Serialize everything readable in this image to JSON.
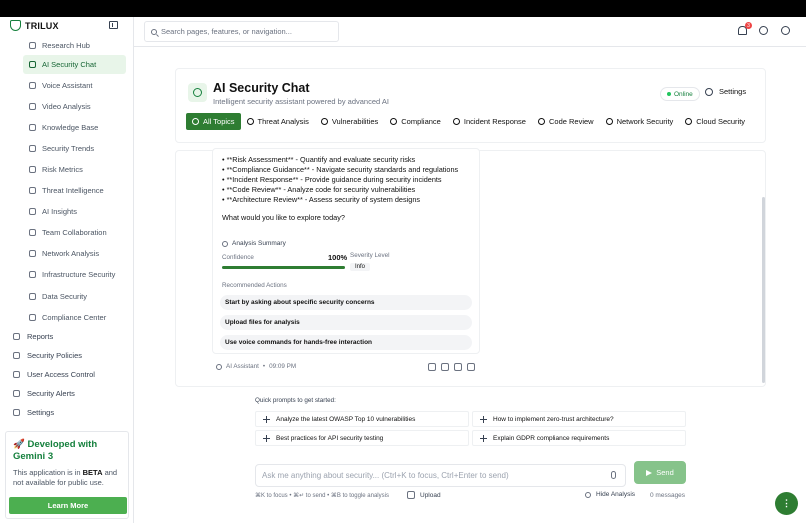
{
  "brand": {
    "name": "TRILUX"
  },
  "sidebar": {
    "items": [
      {
        "label": "Research Hub",
        "icon": "search-icon",
        "active": false
      },
      {
        "label": "AI Security Chat",
        "icon": "chat-icon",
        "active": true
      },
      {
        "label": "Voice Assistant",
        "icon": "mic-icon",
        "active": false
      },
      {
        "label": "Video Analysis",
        "icon": "video-icon",
        "active": false
      },
      {
        "label": "Knowledge Base",
        "icon": "book-icon",
        "active": false
      },
      {
        "label": "Security Trends",
        "icon": "trend-icon",
        "active": false
      },
      {
        "label": "Risk Metrics",
        "icon": "chart-icon",
        "active": false
      },
      {
        "label": "Threat Intelligence",
        "icon": "target-icon",
        "active": false
      },
      {
        "label": "AI Insights",
        "icon": "bulb-icon",
        "active": false
      },
      {
        "label": "Team Collaboration",
        "icon": "users-icon",
        "active": false
      },
      {
        "label": "Network Analysis",
        "icon": "network-icon",
        "active": false
      },
      {
        "label": "Infrastructure Security",
        "icon": "server-icon",
        "active": false
      },
      {
        "label": "Data Security",
        "icon": "database-icon",
        "active": false
      },
      {
        "label": "Compliance Center",
        "icon": "lock-icon",
        "active": false
      }
    ],
    "top_items": [
      {
        "label": "Reports",
        "icon": "file-icon"
      },
      {
        "label": "Security Policies",
        "icon": "shield-icon"
      },
      {
        "label": "User Access Control",
        "icon": "user-circle-icon"
      },
      {
        "label": "Security Alerts",
        "icon": "alert-icon"
      },
      {
        "label": "Settings",
        "icon": "sliders-icon"
      }
    ],
    "gemini": {
      "title": "🚀 Developed with Gemini 3",
      "body_prefix": "This application is in ",
      "body_bold": "BETA",
      "body_suffix": " and not available for public use.",
      "button": "Learn More"
    }
  },
  "header": {
    "search_placeholder": "Search pages, features, or navigation...",
    "notification_count": "3"
  },
  "chat": {
    "title": "AI Security Chat",
    "subtitle": "Intelligent security assistant powered by advanced AI",
    "status": "Online",
    "settings_label": "Settings",
    "tabs": [
      {
        "label": "All Topics",
        "active": true
      },
      {
        "label": "Threat Analysis",
        "active": false
      },
      {
        "label": "Vulnerabilities",
        "active": false
      },
      {
        "label": "Compliance",
        "active": false
      },
      {
        "label": "Incident Response",
        "active": false
      },
      {
        "label": "Code Review",
        "active": false
      },
      {
        "label": "Network Security",
        "active": false
      },
      {
        "label": "Cloud Security",
        "active": false
      }
    ]
  },
  "message": {
    "lines": [
      "• **Risk Assessment** - Quantify and evaluate security risks",
      "• **Compliance Guidance** - Navigate security standards and regulations",
      "• **Incident Response** - Provide guidance during security incidents",
      "• **Code Review** - Analyze code for security vulnerabilities",
      "• **Architecture Review** - Assess security of system designs"
    ],
    "question": "What would you like to explore today?",
    "analysis": {
      "title": "Analysis Summary",
      "confidence_label": "Confidence",
      "confidence_value": "100%",
      "confidence_fraction": 1.0,
      "severity_label": "Severity Level",
      "severity_value": "Info",
      "recommended_label": "Recommended Actions",
      "actions": [
        "Start by asking about specific security concerns",
        "Upload files for analysis",
        "Use voice commands for hands-free interaction"
      ]
    },
    "sender": "AI Assistant",
    "separator": "•",
    "time": "09:09 PM"
  },
  "quick_prompts": {
    "title": "Quick prompts to get started:",
    "items": [
      "Analyze the latest OWASP Top 10 vulnerabilities",
      "How to implement zero-trust architecture?",
      "Best practices for API security testing",
      "Explain GDPR compliance requirements"
    ]
  },
  "composer": {
    "placeholder": "Ask me anything about security... (Ctrl+K to focus, Ctrl+Enter to send)",
    "send_label": "Send",
    "hint": "⌘K to focus • ⌘↵ to send • ⌘B to toggle analysis",
    "upload_label": "Upload",
    "hide_analysis_label": "Hide Analysis",
    "message_count": "0 messages"
  },
  "colors": {
    "accent": "#2e7d32",
    "accent_light": "#e8f5e9",
    "send": "#86c38a",
    "badge": "#ef4444"
  }
}
